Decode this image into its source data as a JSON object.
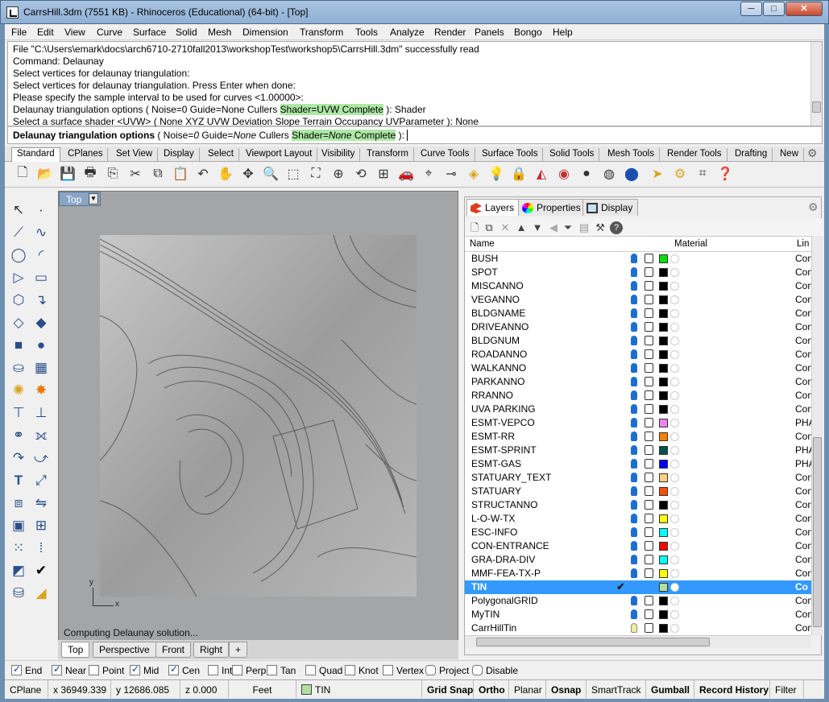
{
  "window": {
    "title": "CarrsHill.3dm (7551 KB) - Rhinoceros (Educational) (64-bit) - [Top]",
    "min": "─",
    "max": "□",
    "close": "✕"
  },
  "menu": [
    "File",
    "Edit",
    "View",
    "Curve",
    "Surface",
    "Solid",
    "Mesh",
    "Dimension",
    "Transform",
    "Tools",
    "Analyze",
    "Render",
    "Panels",
    "Bongo",
    "Help"
  ],
  "history": {
    "l1": "File \"C:\\Users\\emark\\docs\\arch6710-2710fall2013\\workshopTest\\workshop5\\CarrsHill.3dm\" successfully read",
    "l2": "Command: Delaunay",
    "l3": "Select vertices for delaunay triangulation:",
    "l4": "Select vertices for delaunay triangulation. Press Enter when done:",
    "l5": "Please specify the sample interval to be used for curves <1.00000>:",
    "l6a": "Delaunay triangulation options ( Noise=0  Guide=None  Cullers ",
    "l6b": "Shader=UVW  Complete",
    "l6c": " ): Shader",
    "l7": "Select a surface shader <UVW> ( None  XYZ  UVW  Deviation  Slope  Terrain  Occupancy  UVParameter ): None"
  },
  "prompt": {
    "label": "Delaunay triangulation options",
    "a": " ( Noise=",
    "a_val": "0",
    "b": "  Guide=",
    "b_val": "None",
    "c": "  Cullers  ",
    "d": "Shader=",
    "d_val": "None",
    "e": "  Complete",
    "f": " ):"
  },
  "tabs": [
    "Standard",
    "CPlanes",
    "Set View",
    "Display",
    "Select",
    "Viewport Layout",
    "Visibility",
    "Transform",
    "Curve Tools",
    "Surface Tools",
    "Solid Tools",
    "Mesh Tools",
    "Render Tools",
    "Drafting",
    "New"
  ],
  "viewport": {
    "name": "Top",
    "dropdown": "▼",
    "status": "Computing Delaunay solution...",
    "axis_y": "y",
    "axis_x": "x"
  },
  "viewport_tabs": [
    "Top",
    "Perspective",
    "Front",
    "Right",
    "+"
  ],
  "panel": {
    "tabs": [
      "Layers",
      "Properties",
      "Display"
    ],
    "col_name": "Name",
    "col_material": "Material",
    "col_linetype": "Lin",
    "layers": [
      {
        "name": "BUSH",
        "color": "#00e000",
        "on": true,
        "lt": "Con"
      },
      {
        "name": "SPOT",
        "color": "#000000",
        "on": true,
        "lt": "Con"
      },
      {
        "name": "MISCANNO",
        "color": "#000000",
        "on": true,
        "lt": "Con"
      },
      {
        "name": "VEGANNO",
        "color": "#000000",
        "on": true,
        "lt": "Con"
      },
      {
        "name": "BLDGNAME",
        "color": "#000000",
        "on": true,
        "lt": "Con"
      },
      {
        "name": "DRIVEANNO",
        "color": "#000000",
        "on": true,
        "lt": "Con"
      },
      {
        "name": "BLDGNUM",
        "color": "#000000",
        "on": true,
        "lt": "Con"
      },
      {
        "name": "ROADANNO",
        "color": "#000000",
        "on": true,
        "lt": "Con"
      },
      {
        "name": "WALKANNO",
        "color": "#000000",
        "on": true,
        "lt": "Con"
      },
      {
        "name": "PARKANNO",
        "color": "#000000",
        "on": true,
        "lt": "Con"
      },
      {
        "name": "RRANNO",
        "color": "#000000",
        "on": true,
        "lt": "Con"
      },
      {
        "name": "UVA PARKING",
        "color": "#000000",
        "on": true,
        "lt": "Con"
      },
      {
        "name": "ESMT-VEPCO",
        "color": "#ee82ee",
        "on": true,
        "lt": "PHA"
      },
      {
        "name": "ESMT-RR",
        "color": "#ff8000",
        "on": true,
        "lt": "Con"
      },
      {
        "name": "ESMT-SPRINT",
        "color": "#005050",
        "on": true,
        "lt": "PHA"
      },
      {
        "name": "ESMT-GAS",
        "color": "#0000ff",
        "on": true,
        "lt": "PHA"
      },
      {
        "name": "STATUARY_TEXT",
        "color": "#ffd080",
        "on": true,
        "lt": "Con"
      },
      {
        "name": "STATUARY",
        "color": "#ff5000",
        "on": true,
        "lt": "Con"
      },
      {
        "name": "STRUCTANNO",
        "color": "#000000",
        "on": true,
        "lt": "Con"
      },
      {
        "name": "L-O-W-TX",
        "color": "#ffff00",
        "on": true,
        "lt": "Con"
      },
      {
        "name": "ESC-INFO",
        "color": "#00ffff",
        "on": true,
        "lt": "Con"
      },
      {
        "name": "CON-ENTRANCE",
        "color": "#ff0000",
        "on": true,
        "lt": "Con"
      },
      {
        "name": "GRA-DRA-DIV",
        "color": "#00ffff",
        "on": true,
        "lt": "Con"
      },
      {
        "name": "MMF-FEA-TX-P",
        "color": "#ffff00",
        "on": true,
        "lt": "Con"
      },
      {
        "name": "TIN",
        "color": "#b0e0a0",
        "on": true,
        "lt": "Co",
        "current": true
      },
      {
        "name": "PolygonalGRID",
        "color": "#000000",
        "on": true,
        "lt": "Con"
      },
      {
        "name": "MyTIN",
        "color": "#000000",
        "on": true,
        "lt": "Con"
      },
      {
        "name": "CarrHillTin",
        "color": "#000000",
        "on": false,
        "lt": "Con"
      }
    ]
  },
  "osnap": [
    {
      "label": "End",
      "on": true
    },
    {
      "label": "Near",
      "on": true
    },
    {
      "label": "Point",
      "on": false
    },
    {
      "label": "Mid",
      "on": true
    },
    {
      "label": "Cen",
      "on": true
    },
    {
      "label": "Int",
      "on": false
    },
    {
      "label": "Perp",
      "on": false
    },
    {
      "label": "Tan",
      "on": false
    },
    {
      "label": "Quad",
      "on": false
    },
    {
      "label": "Knot",
      "on": false
    },
    {
      "label": "Vertex",
      "on": false
    },
    {
      "label": "Project",
      "on": false
    },
    {
      "label": "Disable",
      "on": false
    }
  ],
  "status": {
    "cplane": "CPlane",
    "x": "x 36949.339",
    "y": "y 12686.085",
    "z": "z 0.000",
    "units": "Feet",
    "layer": "TIN",
    "layer_color": "#b0e0a0",
    "buttons": [
      "Grid Snap",
      "Ortho",
      "Planar",
      "Osnap",
      "SmartTrack",
      "Gumball",
      "Record History",
      "Filter"
    ]
  }
}
